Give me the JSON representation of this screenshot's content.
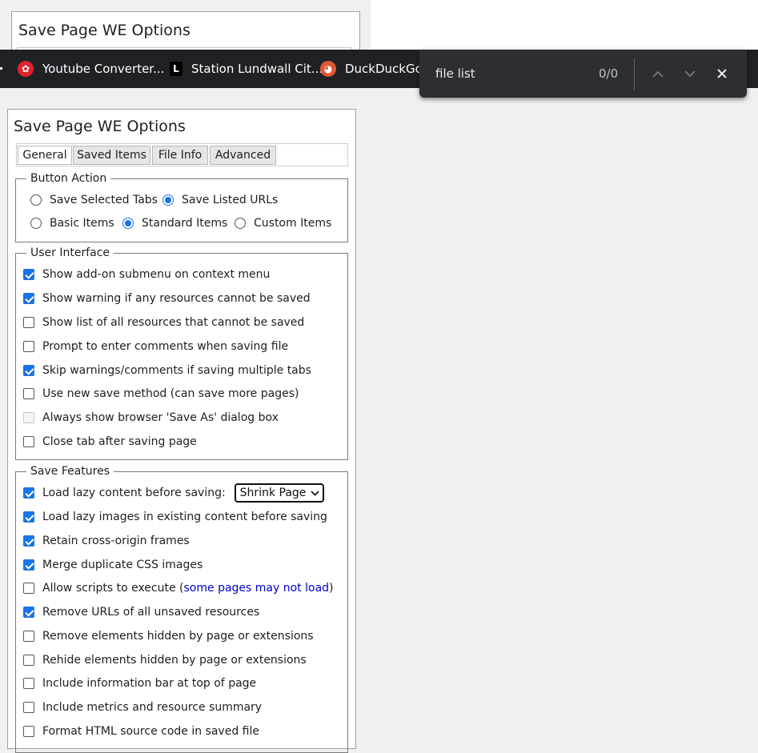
{
  "options_title": "Save Page WE Options",
  "bookmarks": [
    {
      "label": "Youtube Converter..."
    },
    {
      "label": "Station Lundwall Cit..."
    },
    {
      "label": "DuckDuckGo -"
    }
  ],
  "find": {
    "query": "file list",
    "count": "0/0"
  },
  "tabs": [
    "General",
    "Saved Items",
    "File Info",
    "Advanced"
  ],
  "button_action": {
    "legend": "Button Action",
    "row1": [
      {
        "label": "Save Selected Tabs",
        "checked": false
      },
      {
        "label": "Save Listed URLs",
        "checked": true
      }
    ],
    "row2": [
      {
        "label": "Basic Items",
        "checked": false
      },
      {
        "label": "Standard Items",
        "checked": true
      },
      {
        "label": "Custom Items",
        "checked": false
      }
    ]
  },
  "user_interface": {
    "legend": "User Interface",
    "items": [
      {
        "label": "Show add-on submenu on context menu",
        "checked": true
      },
      {
        "label": "Show warning if any resources cannot be saved",
        "checked": true
      },
      {
        "label": "Show list of all resources that cannot be saved",
        "checked": false
      },
      {
        "label": "Prompt to enter comments when saving file",
        "checked": false
      },
      {
        "label": "Skip warnings/comments if saving multiple tabs",
        "checked": true
      },
      {
        "label": "Use new save method (can save more pages)",
        "checked": false
      },
      {
        "label": "Always show browser 'Save As' dialog box",
        "checked": false,
        "disabled": true
      },
      {
        "label": "Close tab after saving page",
        "checked": false
      }
    ]
  },
  "save_features": {
    "legend": "Save Features",
    "lazy_label": "Load lazy content before saving:",
    "lazy_select": "Shrink Page",
    "items": [
      {
        "label": "Load lazy images in existing content before saving",
        "checked": true
      },
      {
        "label": "Retain cross-origin frames",
        "checked": true
      },
      {
        "label": "Merge duplicate CSS images",
        "checked": true
      },
      {
        "label": "Allow scripts to execute (",
        "link": "some pages may not load",
        "suffix": ")",
        "checked": false
      },
      {
        "label": "Remove URLs of all unsaved resources",
        "checked": true
      },
      {
        "label": "Remove elements hidden by page or extensions",
        "checked": false
      },
      {
        "label": "Rehide elements hidden by page or extensions",
        "checked": false
      },
      {
        "label": "Include information bar at top of page",
        "checked": false
      },
      {
        "label": "Include metrics and resource summary",
        "checked": false
      },
      {
        "label": "Format HTML source code in saved file",
        "checked": false
      }
    ]
  },
  "colors": {
    "accent": "#1a73e8",
    "toolbar": "#202124",
    "findbar": "#2d2e31",
    "link": "#0000cc"
  }
}
